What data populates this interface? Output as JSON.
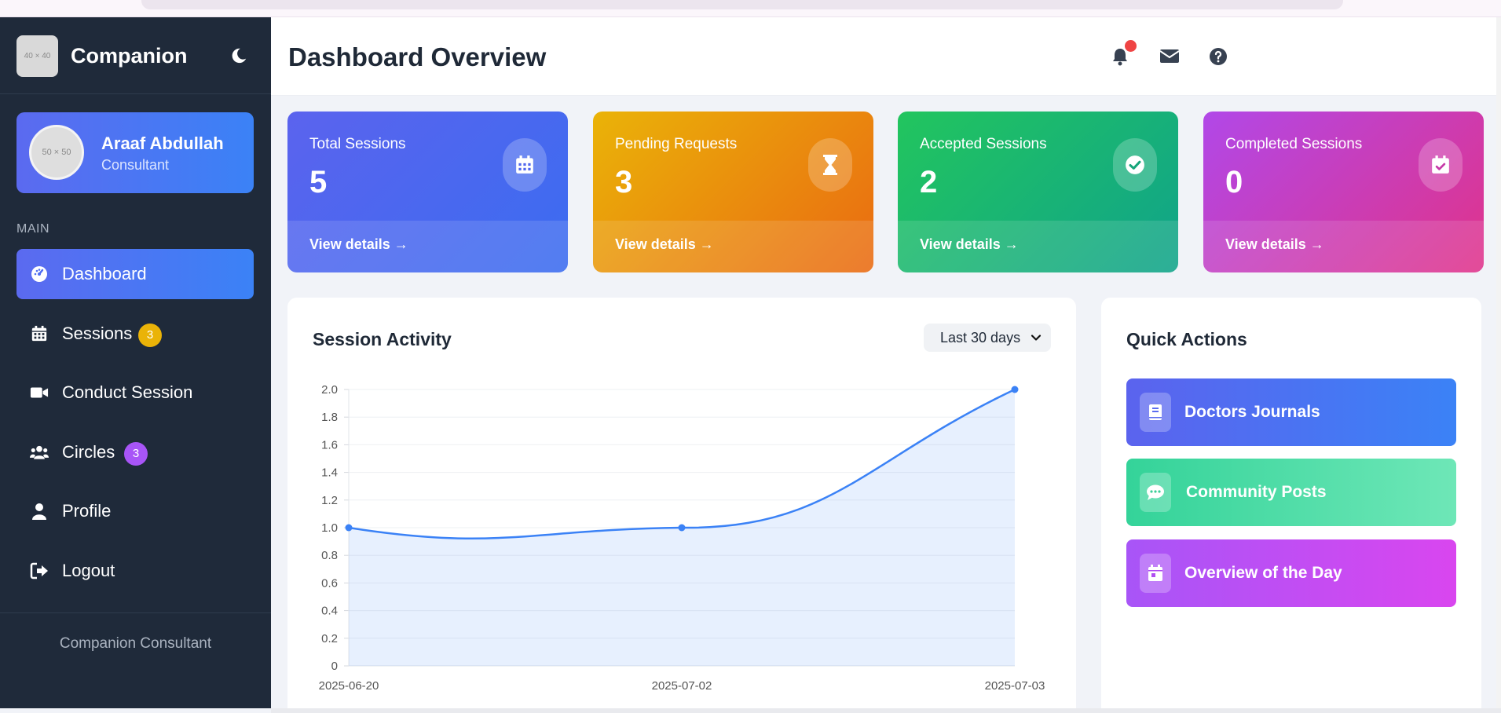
{
  "brand": {
    "logo_placeholder": "40 × 40",
    "name": "Companion"
  },
  "profile": {
    "avatar_placeholder": "50 × 50",
    "name": "Araaf Abdullah",
    "role": "Consultant"
  },
  "sidebar": {
    "section_label": "MAIN",
    "items": [
      {
        "label": "Dashboard",
        "icon": "gauge-icon"
      },
      {
        "label": "Sessions",
        "icon": "calendar-icon",
        "badge": "3"
      },
      {
        "label": "Conduct Session",
        "icon": "video-icon"
      },
      {
        "label": "Circles",
        "icon": "users-icon",
        "badge": "3"
      },
      {
        "label": "Profile",
        "icon": "user-icon"
      },
      {
        "label": "Logout",
        "icon": "logout-icon"
      }
    ],
    "footer": "Companion Consultant"
  },
  "header": {
    "title": "Dashboard Overview"
  },
  "stats": [
    {
      "label": "Total Sessions",
      "value": "5",
      "link": "View details →",
      "icon": "calendar-icon",
      "colors": [
        "#5b63ee",
        "#3b6cf0"
      ]
    },
    {
      "label": "Pending Requests",
      "value": "3",
      "link": "View details →",
      "icon": "hourglass-icon",
      "colors": [
        "#eab308",
        "#ea6a12"
      ]
    },
    {
      "label": "Accepted Sessions",
      "value": "2",
      "link": "View details →",
      "icon": "check-circle-icon",
      "colors": [
        "#22c55e",
        "#10a38a"
      ]
    },
    {
      "label": "Completed Sessions",
      "value": "0",
      "link": "View details →",
      "icon": "calendar-check-icon",
      "colors": [
        "#b148e8",
        "#e0338a"
      ]
    }
  ],
  "chart": {
    "title": "Session Activity",
    "range_selected": "Last 30 days"
  },
  "chart_data": {
    "type": "area",
    "x": [
      "2025-06-20",
      "2025-07-02",
      "2025-07-03"
    ],
    "series": [
      {
        "values": [
          1,
          1,
          2
        ]
      }
    ],
    "ylim": [
      0,
      2
    ],
    "yticks": [
      "0",
      "0.2",
      "0.4",
      "0.6",
      "0.8",
      "1.0",
      "1.2",
      "1.4",
      "1.6",
      "1.8",
      "2.0"
    ],
    "grid": true,
    "line_color": "#3b82f6"
  },
  "quick_actions": {
    "title": "Quick Actions",
    "items": [
      {
        "label": "Doctors Journals",
        "icon": "book-icon",
        "colors": [
          "#5b63ee",
          "#3b82f6"
        ]
      },
      {
        "label": "Community Posts",
        "icon": "comment-icon",
        "colors": [
          "#34d399",
          "#6ee7b7"
        ]
      },
      {
        "label": "Overview of the Day",
        "icon": "calendar-day-icon",
        "colors": [
          "#a855f7",
          "#d946ef"
        ]
      }
    ]
  }
}
